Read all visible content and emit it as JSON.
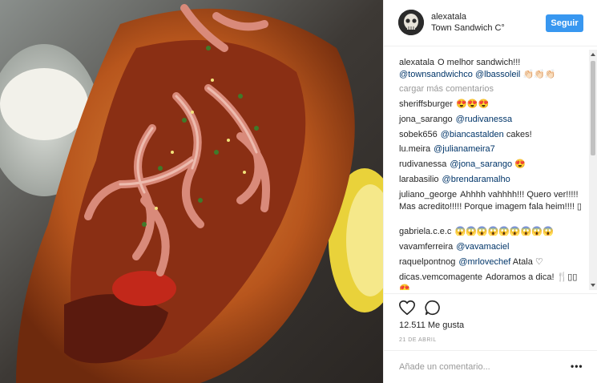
{
  "post": {
    "username": "alexatala",
    "location": "Town Sandwich C°",
    "follow_label": "Seguir"
  },
  "caption": {
    "user": "alexatala",
    "text": "O melhor sandwich!!!",
    "mention1": "@townsandwichco",
    "mention2": "@lbassoleil",
    "emoji": "👏🏻👏🏻👏🏻"
  },
  "load_more": "cargar más comentarios",
  "comments": [
    {
      "user": "sheriffsburger",
      "text": "",
      "mention": "",
      "emoji": "😍😍😍"
    },
    {
      "user": "jona_sarango",
      "text": "",
      "mention": "@rudivanessa",
      "emoji": ""
    },
    {
      "user": "sobek656",
      "text": " cakes!",
      "mention": "@biancastalden",
      "emoji": ""
    },
    {
      "user": "lu.meira",
      "text": "",
      "mention": "@julianameira7",
      "emoji": ""
    },
    {
      "user": "rudivanessa",
      "text": "",
      "mention": "@jona_sarango",
      "emoji": "😍"
    },
    {
      "user": "larabasilio",
      "text": "",
      "mention": "@brendaramalho",
      "emoji": ""
    },
    {
      "user": "juliano_george",
      "text": "Ahhhh vahhhh!!! Quero ver!!!!! Mas acredito!!!!! Porque imagem fala heim!!!! ▯",
      "mention": "",
      "emoji": ""
    },
    {
      "user": "gabriela.c.e.c",
      "text": "",
      "mention": "",
      "emoji": "😱😱😱😱😱😱😱😱😱"
    },
    {
      "user": "vavamferreira",
      "text": "",
      "mention": "@vavamaciel",
      "emoji": ""
    },
    {
      "user": "raquelpontnog",
      "text": " Atala ♡",
      "mention": "@mrlovechef",
      "emoji": ""
    },
    {
      "user": "dicas.vemcomagente",
      "text": "Adoramos a dica! 🍴▯▯😍",
      "mention": "",
      "emoji": ""
    }
  ],
  "likes": "12.511 Me gusta",
  "date": "21 DE ABRIL",
  "add_comment_placeholder": "Añade un comentario...",
  "more_label": "•••",
  "icons": [
    "heart-icon",
    "comment-icon",
    "more-options-icon"
  ],
  "colors": {
    "accent": "#3897f0",
    "mention": "#003569",
    "muted": "#999999"
  }
}
